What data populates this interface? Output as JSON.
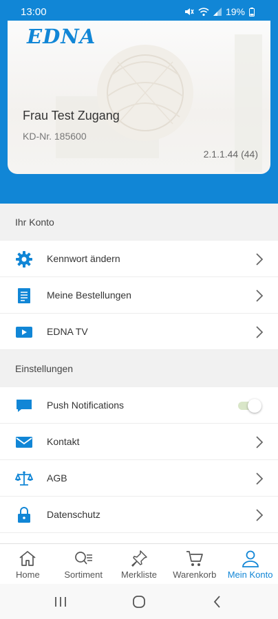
{
  "status_bar": {
    "time": "13:00",
    "battery": "19%"
  },
  "card": {
    "logo": "EDNA",
    "name": "Frau Test Zugang",
    "customer_number": "KD-Nr. 185600",
    "version": "2.1.1.44 (44)"
  },
  "account_section": {
    "title": "Ihr Konto",
    "items": [
      {
        "label": "Kennwort ändern",
        "icon": "gear-icon"
      },
      {
        "label": "Meine Bestellungen",
        "icon": "document-icon"
      },
      {
        "label": "EDNA TV",
        "icon": "play-icon"
      }
    ]
  },
  "settings_section": {
    "title": "Einstellungen",
    "items": [
      {
        "label": "Push Notifications",
        "icon": "chat-icon",
        "toggle": true
      },
      {
        "label": "Kontakt",
        "icon": "mail-icon"
      },
      {
        "label": "AGB",
        "icon": "scale-icon"
      },
      {
        "label": "Datenschutz",
        "icon": "lock-icon"
      }
    ]
  },
  "bottom_nav": {
    "items": [
      {
        "label": "Home",
        "icon": "home-icon"
      },
      {
        "label": "Sortiment",
        "icon": "search-list-icon"
      },
      {
        "label": "Merkliste",
        "icon": "pin-icon"
      },
      {
        "label": "Warenkorb",
        "icon": "cart-icon"
      },
      {
        "label": "Mein Konto",
        "icon": "user-icon",
        "active": true
      }
    ]
  },
  "colors": {
    "brand": "#1186d6",
    "section_bg": "#f1f1f1"
  }
}
